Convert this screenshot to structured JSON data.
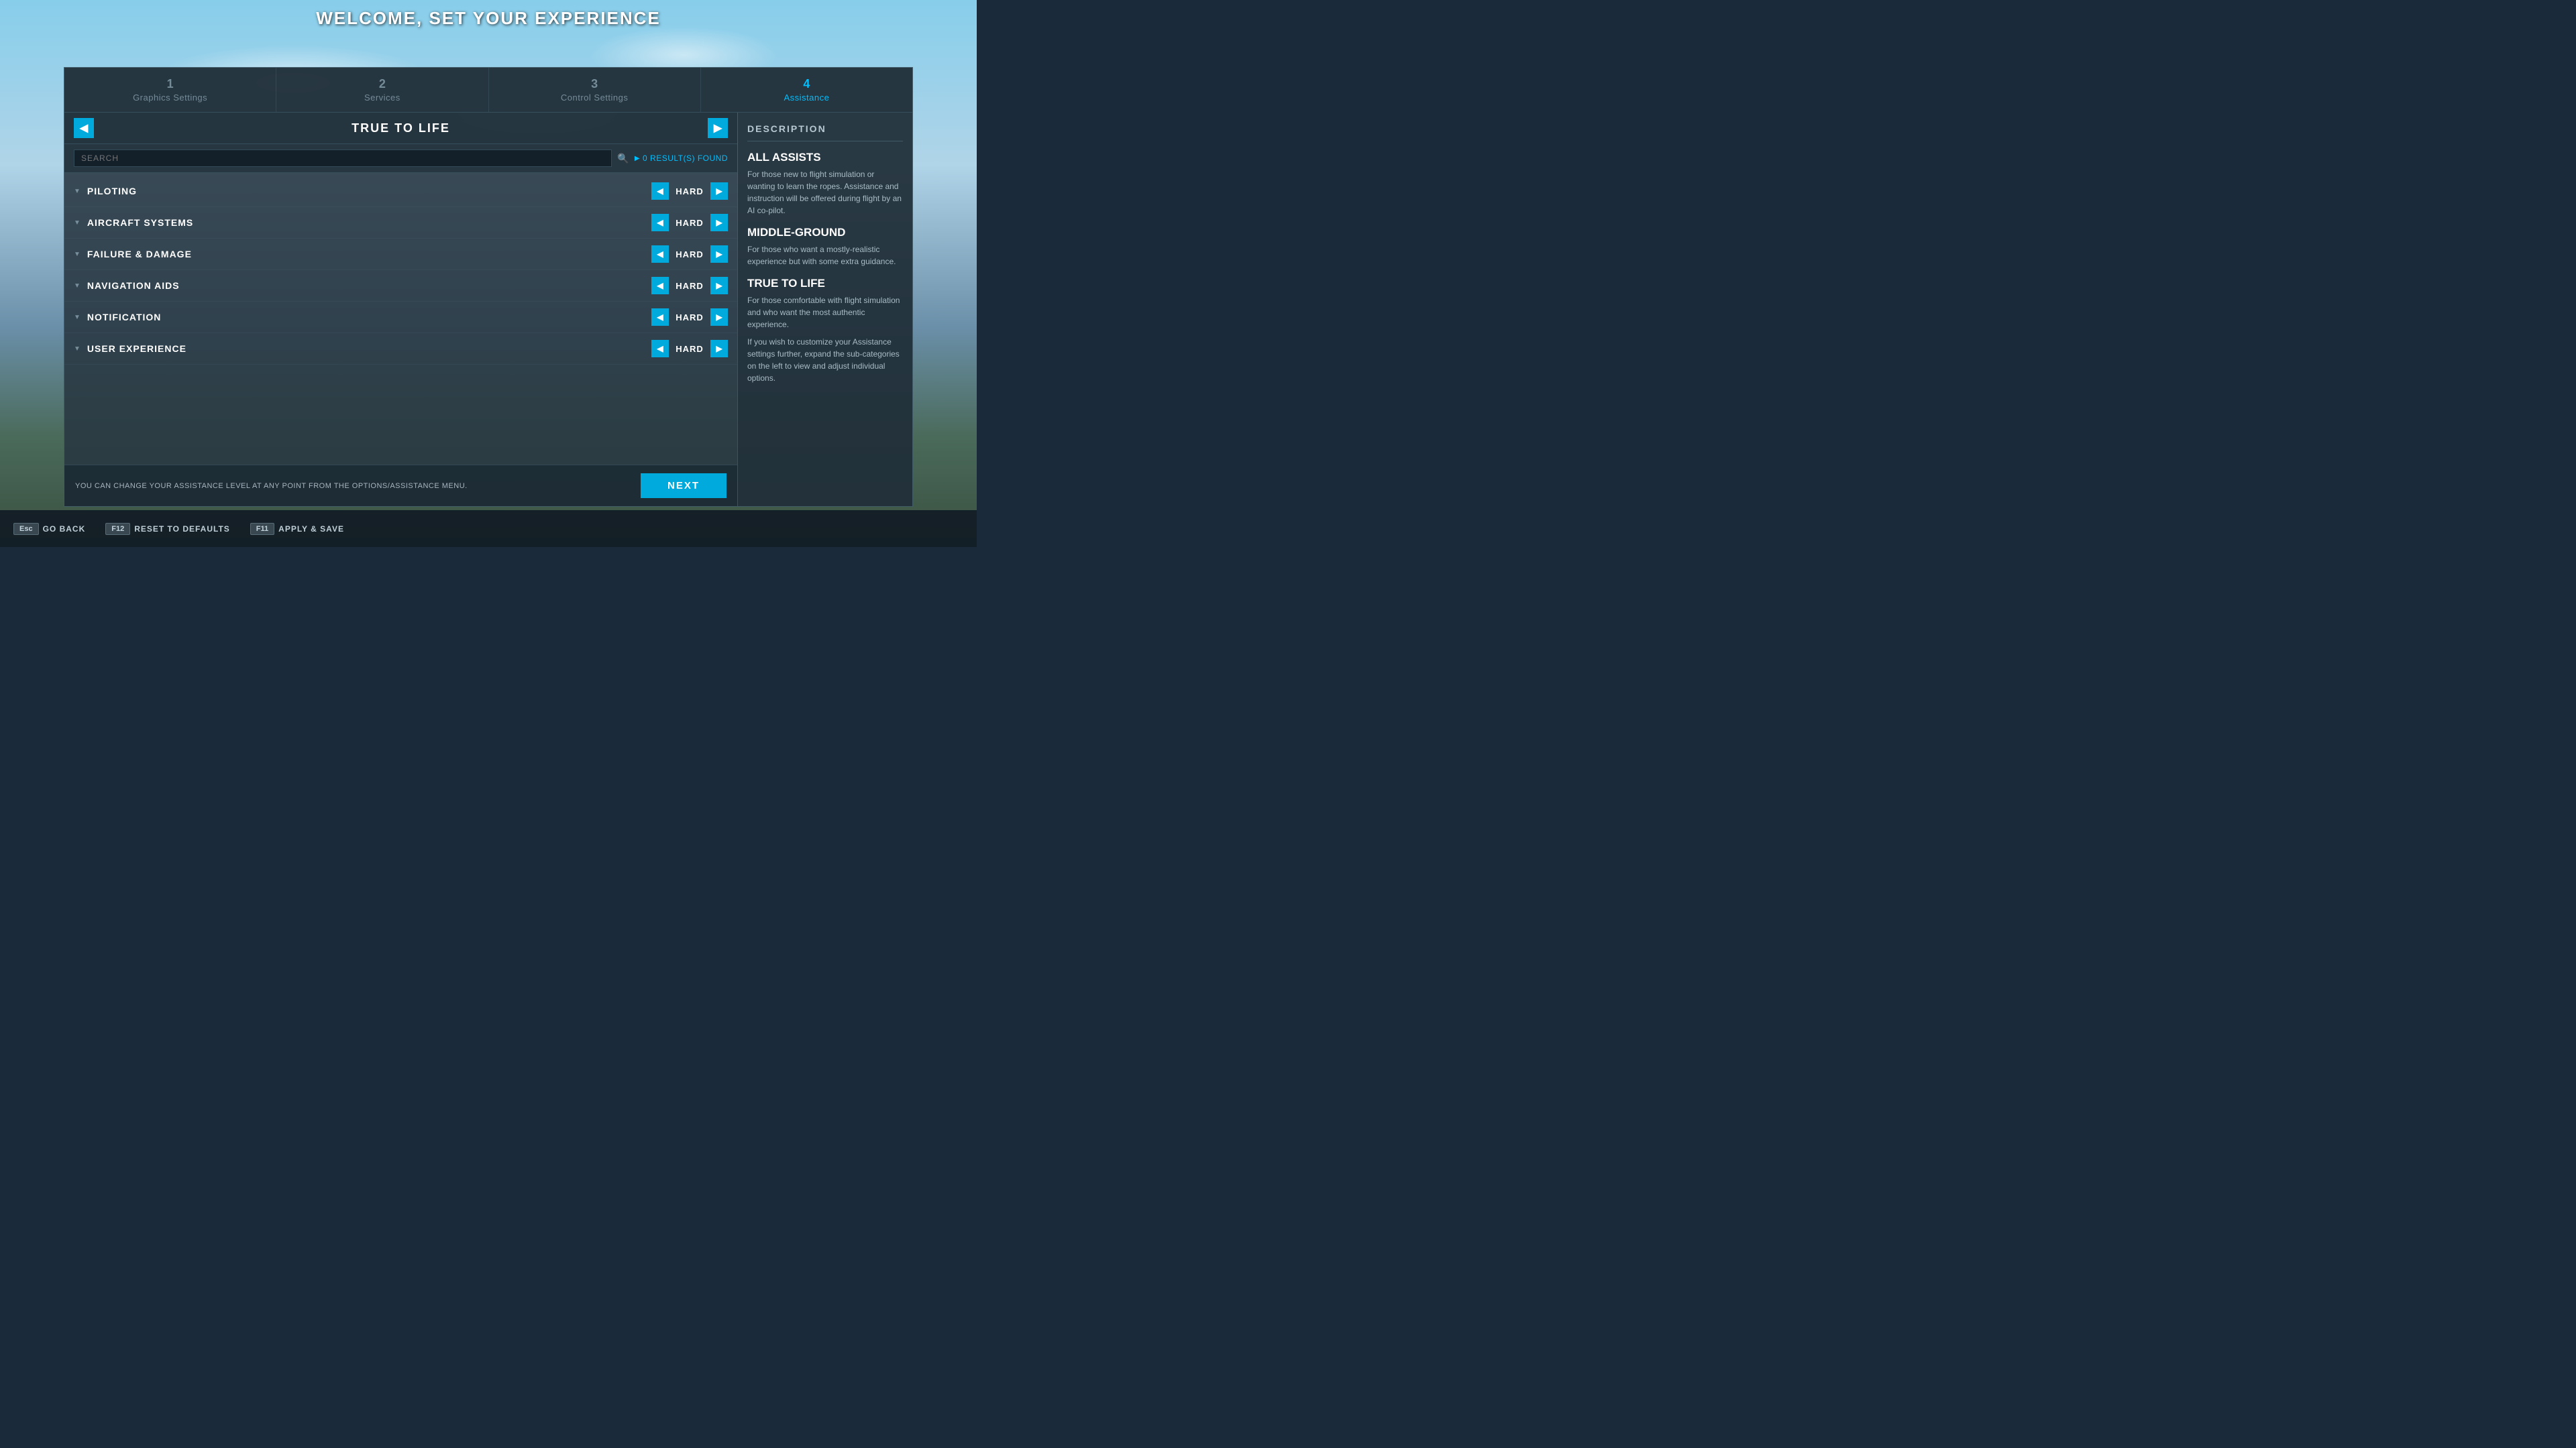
{
  "page": {
    "title": "WELCOME, SET YOUR EXPERIENCE"
  },
  "steps": [
    {
      "id": "step-1",
      "number": "1",
      "label": "Graphics Settings",
      "active": false
    },
    {
      "id": "step-2",
      "number": "2",
      "label": "Services",
      "active": false
    },
    {
      "id": "step-3",
      "number": "3",
      "label": "Control Settings",
      "active": false
    },
    {
      "id": "step-4",
      "number": "4",
      "label": "Assistance",
      "active": true
    }
  ],
  "mode": {
    "current": "TRUE TO LIFE",
    "prev_label": "◀",
    "next_label": "▶"
  },
  "search": {
    "placeholder": "SEARCH",
    "results_text": "0 RESULT(S) FOUND"
  },
  "categories": [
    {
      "name": "PILOTING",
      "value": "HARD"
    },
    {
      "name": "AIRCRAFT SYSTEMS",
      "value": "HARD"
    },
    {
      "name": "FAILURE & DAMAGE",
      "value": "HARD"
    },
    {
      "name": "NAVIGATION AIDS",
      "value": "HARD"
    },
    {
      "name": "NOTIFICATION",
      "value": "HARD"
    },
    {
      "name": "USER EXPERIENCE",
      "value": "HARD"
    }
  ],
  "bottom_notice": "YOU CAN CHANGE YOUR ASSISTANCE LEVEL AT ANY POINT FROM THE OPTIONS/ASSISTANCE MENU.",
  "next_button": "NEXT",
  "description": {
    "title": "DESCRIPTION",
    "sections": [
      {
        "title": "ALL ASSISTS",
        "text": "For those new to flight simulation or wanting to learn the ropes. Assistance and instruction will be offered during flight by an AI co-pilot."
      },
      {
        "title": "MIDDLE-GROUND",
        "text": "For those who want a mostly-realistic experience but with some extra guidance."
      },
      {
        "title": "TRUE TO LIFE",
        "text": "For those comfortable with flight simulation and who want the most authentic experience."
      },
      {
        "title": "",
        "text": "If you wish to customize your Assistance settings further, expand the sub-categories on the left to view and adjust individual options."
      }
    ]
  },
  "toolbar": [
    {
      "key": "Esc",
      "label": "GO BACK"
    },
    {
      "key": "F12",
      "label": "RESET TO DEFAULTS"
    },
    {
      "key": "F11",
      "label": "APPLY & SAVE"
    }
  ]
}
